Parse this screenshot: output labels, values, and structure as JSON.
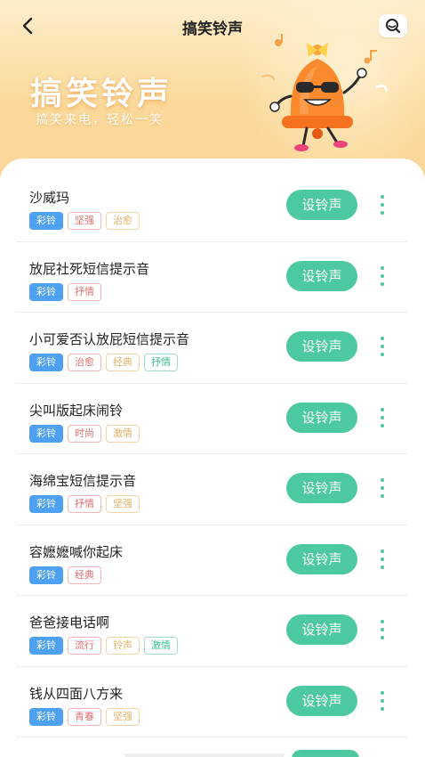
{
  "header": {
    "title": "搞笑铃声",
    "back_icon": "chevron-left-icon",
    "search_icon": "search-icon"
  },
  "banner": {
    "title": "搞笑铃声",
    "subtitle": "搞笑来电，轻松一笑",
    "mascot": "bell-mascot-illustration"
  },
  "list": {
    "set_button_label": "设铃声",
    "more_icon": "more-vertical-icon",
    "items": [
      {
        "title": "沙威玛",
        "tags": [
          {
            "text": "彩铃",
            "style": "color-ring"
          },
          {
            "text": "坚强",
            "style": "red"
          },
          {
            "text": "治愈",
            "style": "yellow"
          }
        ]
      },
      {
        "title": "放屁社死短信提示音",
        "tags": [
          {
            "text": "彩铃",
            "style": "color-ring"
          },
          {
            "text": "抒情",
            "style": "red"
          }
        ]
      },
      {
        "title": "小可爱否认放屁短信提示音",
        "tags": [
          {
            "text": "彩铃",
            "style": "color-ring"
          },
          {
            "text": "治愈",
            "style": "red"
          },
          {
            "text": "经典",
            "style": "yellow"
          },
          {
            "text": "抒情",
            "style": "green"
          }
        ]
      },
      {
        "title": "尖叫版起床闹铃",
        "tags": [
          {
            "text": "彩铃",
            "style": "color-ring"
          },
          {
            "text": "时尚",
            "style": "red"
          },
          {
            "text": "激情",
            "style": "yellow"
          }
        ]
      },
      {
        "title": "海绵宝短信提示音",
        "tags": [
          {
            "text": "彩铃",
            "style": "color-ring"
          },
          {
            "text": "抒情",
            "style": "red"
          },
          {
            "text": "坚强",
            "style": "yellow"
          }
        ]
      },
      {
        "title": "容嬷嬷喊你起床",
        "tags": [
          {
            "text": "彩铃",
            "style": "color-ring"
          },
          {
            "text": "经典",
            "style": "red"
          }
        ]
      },
      {
        "title": "爸爸接电话啊",
        "tags": [
          {
            "text": "彩铃",
            "style": "color-ring"
          },
          {
            "text": "流行",
            "style": "red"
          },
          {
            "text": "铃声",
            "style": "yellow"
          },
          {
            "text": "激情",
            "style": "green"
          }
        ]
      },
      {
        "title": "钱从四面八方来",
        "tags": [
          {
            "text": "彩铃",
            "style": "color-ring"
          },
          {
            "text": "青春",
            "style": "red"
          },
          {
            "text": "坚强",
            "style": "yellow"
          }
        ]
      }
    ]
  },
  "colors": {
    "accent": "#4cc9a0",
    "color_ring_tag": "#4ea0f0",
    "header_gradient_top": "#fdeecb",
    "header_gradient_bottom": "#fbd99a"
  }
}
